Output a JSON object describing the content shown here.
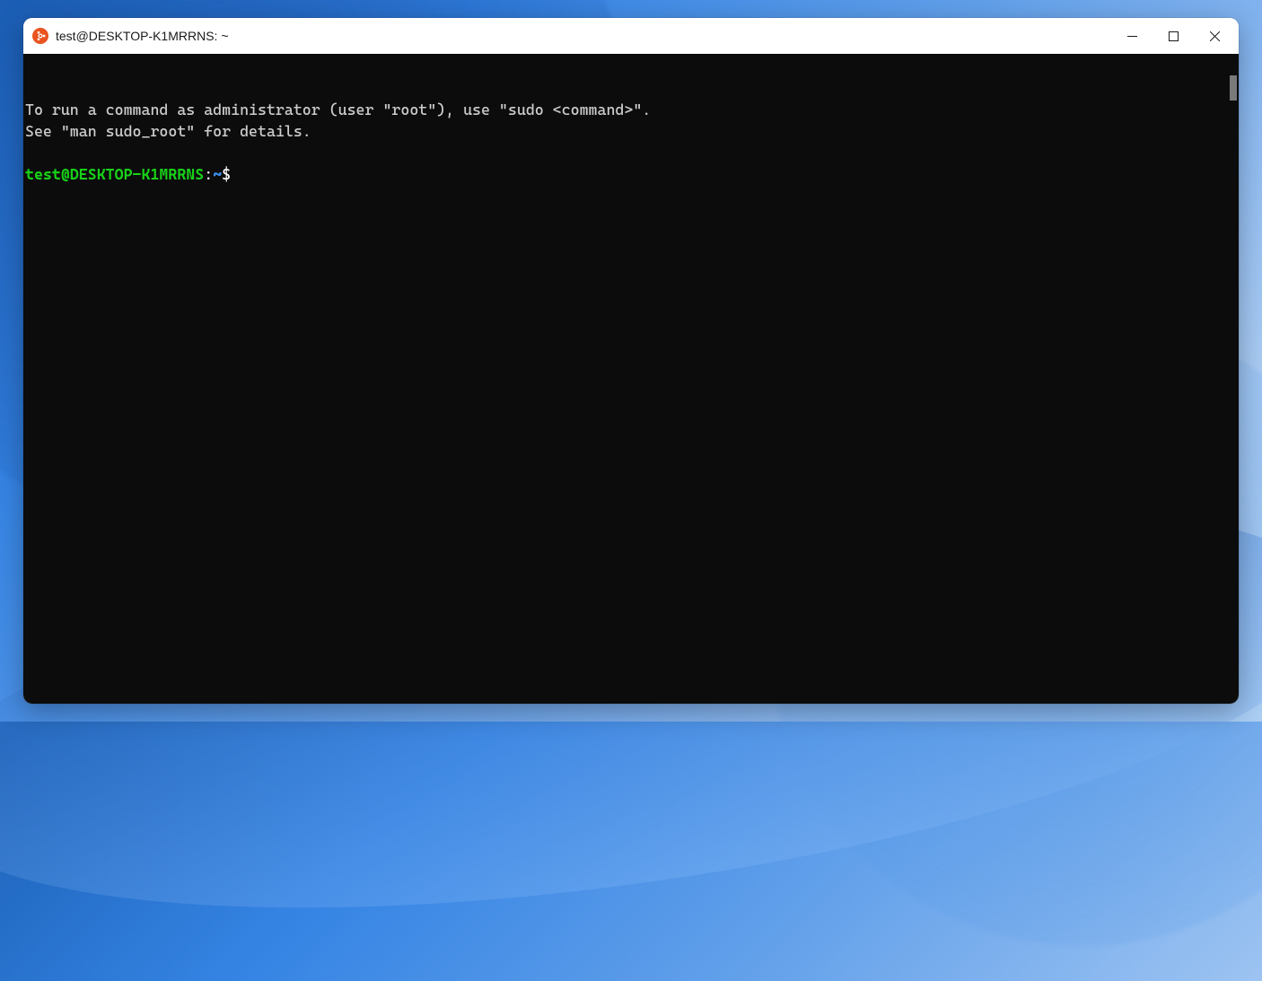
{
  "window": {
    "title": "test@DESKTOP-K1MRRNS: ~",
    "icon": "ubuntu-icon"
  },
  "terminal": {
    "motd_line1": "To run a command as administrator (user \"root\"), use \"sudo <command>\".",
    "motd_line2": "See \"man sudo_root\" for details.",
    "prompt": {
      "user_host": "test@DESKTOP-K1MRRNS",
      "colon": ":",
      "path": "~",
      "dollar": "$"
    }
  },
  "colors": {
    "terminal_bg": "#0c0c0c",
    "terminal_fg": "#cccccc",
    "prompt_user": "#18d118",
    "prompt_path": "#3b8eea"
  }
}
